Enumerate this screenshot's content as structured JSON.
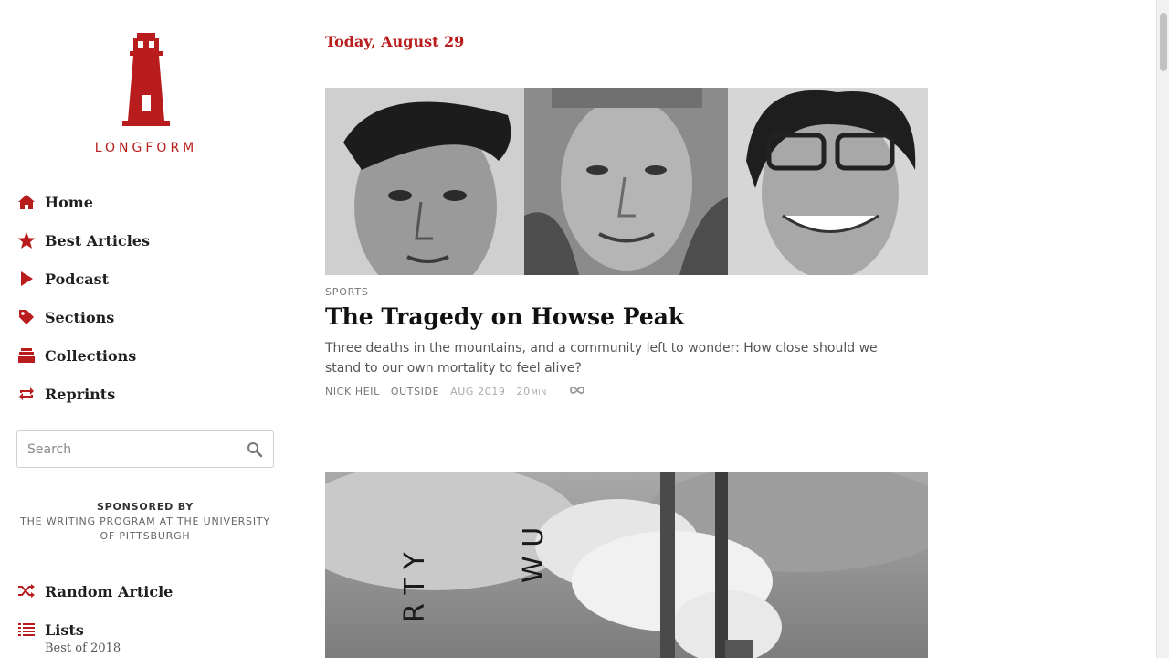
{
  "brand": {
    "name": "LONGFORM",
    "accent": "#b91c1c"
  },
  "nav": {
    "items": [
      {
        "label": "Home",
        "icon": "home-icon"
      },
      {
        "label": "Best Articles",
        "icon": "star-icon"
      },
      {
        "label": "Podcast",
        "icon": "play-icon"
      },
      {
        "label": "Sections",
        "icon": "tag-icon"
      },
      {
        "label": "Collections",
        "icon": "stack-icon"
      },
      {
        "label": "Reprints",
        "icon": "repeat-icon"
      }
    ]
  },
  "search": {
    "placeholder": "Search",
    "icon": "search-icon"
  },
  "sponsor": {
    "head": "SPONSORED BY",
    "body": "THE WRITING PROGRAM AT THE UNIVERSITY OF PITTSBURGH"
  },
  "nav2": {
    "random": {
      "label": "Random Article",
      "icon": "shuffle-icon"
    },
    "lists": {
      "label": "Lists",
      "icon": "list-icon",
      "sub": "Best of 2018"
    }
  },
  "main": {
    "date": "Today, August 29",
    "article": {
      "category": "SPORTS",
      "title": "The Tragedy on Howse Peak",
      "dek": "Three deaths in the mountains, and a community left to wonder: How close should we stand to our own mortality to feel alive?",
      "author": "NICK HEIL",
      "publication": "OUTSIDE",
      "date": "AUG 2019",
      "length": "20",
      "length_unit": "MIN",
      "save_icon": "infinity-icon"
    },
    "next_article_image_text": [
      "R T Y",
      "W U"
    ]
  }
}
